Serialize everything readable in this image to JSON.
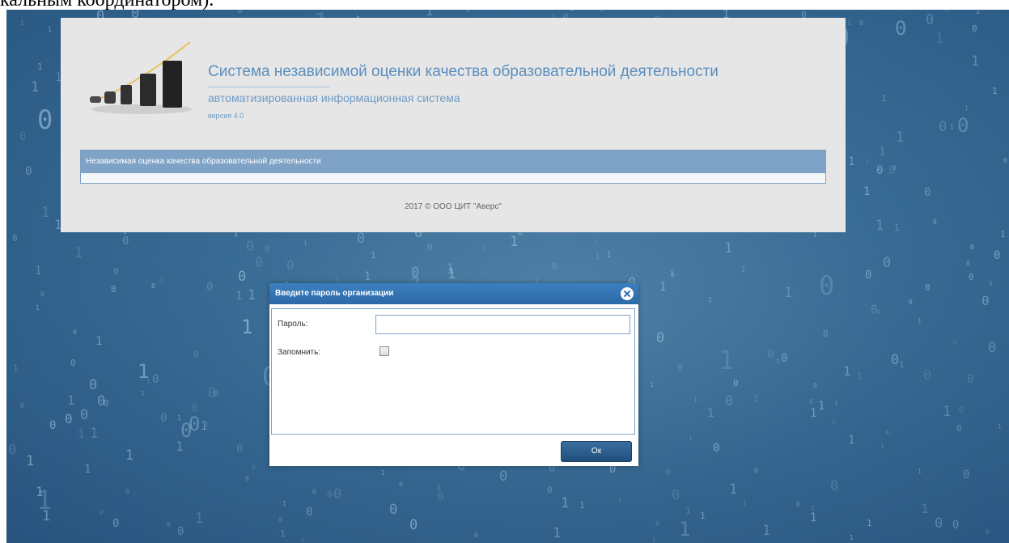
{
  "caption": "кальным координатором).",
  "header": {
    "title": "Система независимой оценки качества образовательной деятельности",
    "subtitle": "автоматизированная информационная система",
    "version": "версия 4.0",
    "nav_text": "Независимая оценка качества образовательной деятельности",
    "copyright": "2017 © ООО ЦИТ \"Аверс\""
  },
  "dialog": {
    "title": "Введите пароль организации",
    "password_label": "Пароль:",
    "password_value": "",
    "remember_label": "Запомнить:",
    "remember_checked": false,
    "ok_label": "Ок"
  },
  "colors": {
    "accent": "#5b8fbd",
    "dialog_titlebar": "#2c6aa8",
    "button": "#1f4f7c"
  },
  "icons": {
    "close": "close-circle-icon",
    "logo": "growth-chart-icon"
  }
}
